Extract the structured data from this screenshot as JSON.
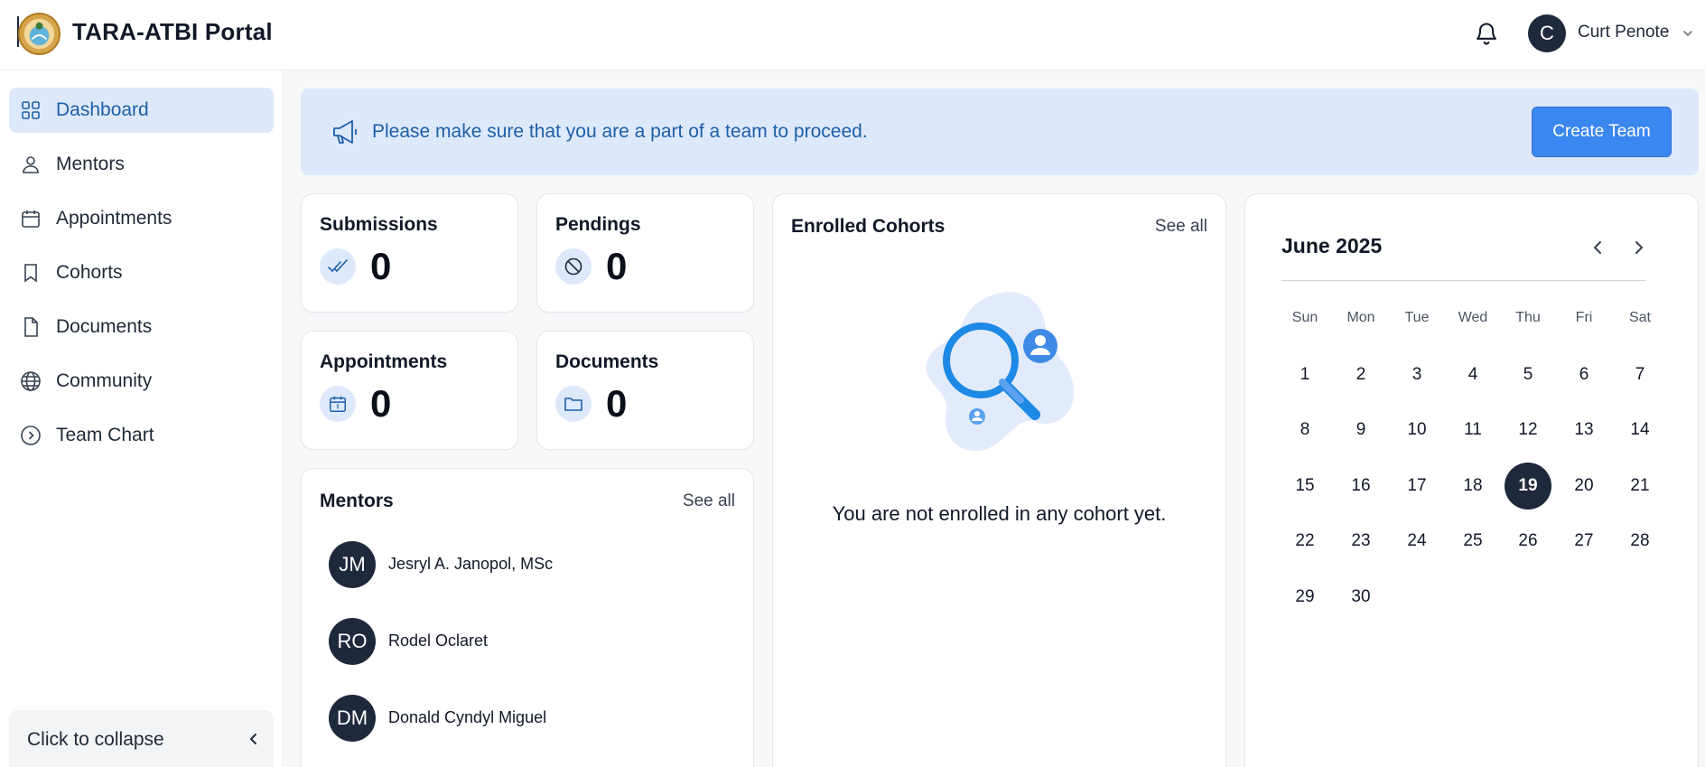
{
  "header": {
    "title": "TARA-ATBI Portal",
    "user_initial": "C",
    "user_name": "Curt Penote"
  },
  "sidebar": {
    "items": [
      {
        "label": "Dashboard",
        "icon": "grid-icon",
        "active": true
      },
      {
        "label": "Mentors",
        "icon": "person-icon"
      },
      {
        "label": "Appointments",
        "icon": "calendar-icon"
      },
      {
        "label": "Cohorts",
        "icon": "bookmark-icon"
      },
      {
        "label": "Documents",
        "icon": "document-icon"
      },
      {
        "label": "Community",
        "icon": "globe-icon"
      },
      {
        "label": "Team Chart",
        "icon": "chevron-circle-icon"
      }
    ],
    "collapse_label": "Click to collapse"
  },
  "banner": {
    "text": "Please make sure that you are a part of a team to proceed.",
    "button_label": "Create Team"
  },
  "stats": {
    "submissions": {
      "title": "Submissions",
      "value": "0"
    },
    "pendings": {
      "title": "Pendings",
      "value": "0"
    },
    "appointments": {
      "title": "Appointments",
      "value": "0"
    },
    "documents": {
      "title": "Documents",
      "value": "0"
    }
  },
  "mentors": {
    "title": "Mentors",
    "see_all": "See all",
    "list": [
      {
        "initials": "JM",
        "name": "Jesryl A. Janopol, MSc"
      },
      {
        "initials": "RO",
        "name": "Rodel Oclaret"
      },
      {
        "initials": "DM",
        "name": "Donald Cyndyl Miguel"
      }
    ]
  },
  "cohorts": {
    "title": "Enrolled Cohorts",
    "see_all": "See all",
    "empty_text": "You are not enrolled in any cohort yet."
  },
  "calendar": {
    "title": "June 2025",
    "weekdays": [
      "Sun",
      "Mon",
      "Tue",
      "Wed",
      "Thu",
      "Fri",
      "Sat"
    ],
    "first_weekday_index": 0,
    "days_in_month": 30,
    "selected_day": 19
  },
  "colors": {
    "accent": "#3b87f0",
    "active_bg": "#dde9fb",
    "active_text": "#1d5fa8",
    "dark": "#1e293b"
  }
}
